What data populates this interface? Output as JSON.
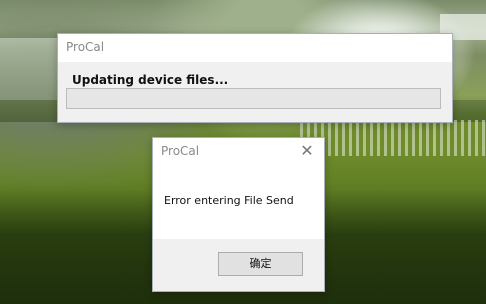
{
  "progress_window": {
    "title": "ProCal",
    "message": "Updating device files...",
    "progress": 0
  },
  "message_box": {
    "title": "ProCal",
    "close_icon": "close-icon",
    "message": "Error entering File Send",
    "ok_label": "确定"
  }
}
